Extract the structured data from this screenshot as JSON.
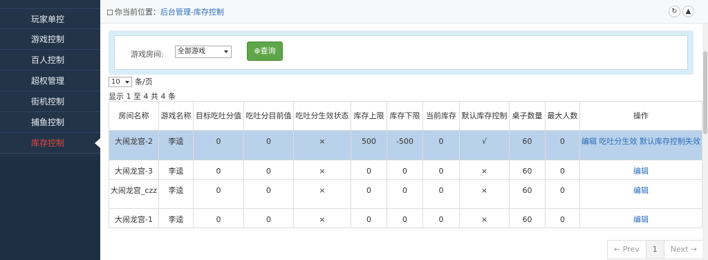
{
  "sidebar": {
    "items": [
      {
        "label": "玩家单控",
        "active": false
      },
      {
        "label": "游戏控制",
        "active": false
      },
      {
        "label": "百人控制",
        "active": false
      },
      {
        "label": "超权管理",
        "active": false
      },
      {
        "label": "街机控制",
        "active": false
      },
      {
        "label": "捕鱼控制",
        "active": false
      },
      {
        "label": "库存控制",
        "active": true
      }
    ],
    "active_color": "#e1483f"
  },
  "breadcrumb": {
    "prefix": "你当前位置：",
    "current": "后台管理-库存控制",
    "icon": "home-icon"
  },
  "header_buttons": {
    "refresh_icon": "refresh-icon",
    "collapse_icon": "chevron-up-icon"
  },
  "filter": {
    "label": "游戏房间:",
    "selected": "全部游戏",
    "query_label": "查询",
    "query_icon": "search-icon",
    "query_color": "#5fa64a"
  },
  "page_size": {
    "value": "10",
    "suffix": "条/页"
  },
  "info": "显示 1 至 4 共 4 条",
  "table": {
    "columns": [
      "房间名称",
      "游戏名称",
      "目标吃吐分值",
      "吃吐分目前值",
      "吃吐分生效状态",
      "库存上限",
      "库存下限",
      "当前库存",
      "默认库存控制",
      "桌子数量",
      "最大人数",
      "操作"
    ],
    "rows": [
      {
        "room": "大闹龙宫-2",
        "game": "李逵",
        "target": "0",
        "current": "0",
        "status": "×",
        "upper": "500",
        "lower": "-500",
        "stock": "0",
        "default": "√",
        "tables": "60",
        "max": "0",
        "op1": "编辑",
        "op2": "吃吐分生效",
        "op3": "默认库存控制失效"
      },
      {
        "room": "大闹龙宫-3",
        "game": "李逵",
        "target": "0",
        "current": "0",
        "status": "×",
        "upper": "0",
        "lower": "0",
        "stock": "0",
        "default": "×",
        "tables": "60",
        "max": "0",
        "op1": "编辑"
      },
      {
        "room": "大闹龙宫_czz",
        "game": "李逵",
        "target": "0",
        "current": "0",
        "status": "×",
        "upper": "0",
        "lower": "0",
        "stock": "0",
        "default": "×",
        "tables": "60",
        "max": "0",
        "op1": "编辑"
      },
      {
        "room": "大闹龙宫-1",
        "game": "李逵",
        "target": "0",
        "current": "0",
        "status": "×",
        "upper": "0",
        "lower": "0",
        "stock": "0",
        "default": "×",
        "tables": "60",
        "max": "0",
        "op1": "编辑"
      }
    ],
    "selected_row_color": "#b9d1ea"
  },
  "pagination": {
    "prev": "← Prev",
    "page": "1",
    "next": "Next →"
  }
}
